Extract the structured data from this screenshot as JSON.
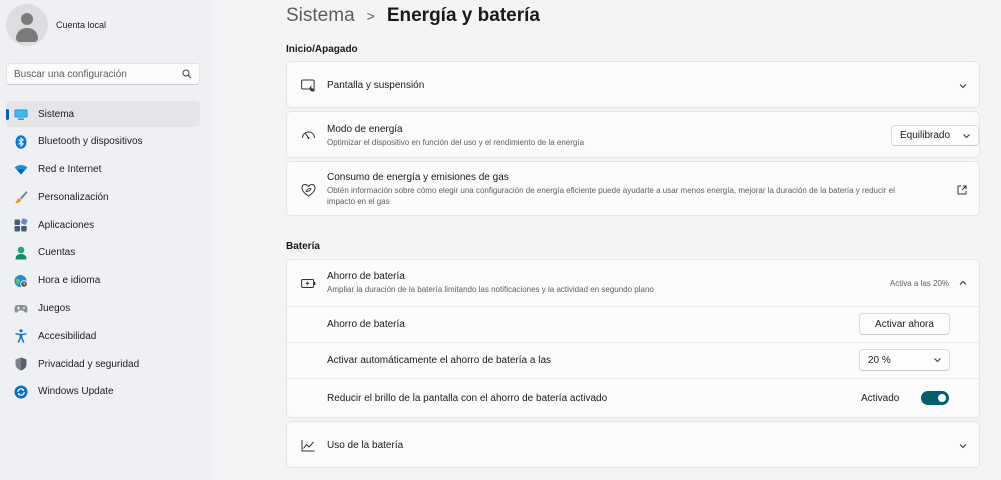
{
  "profile": {
    "name": "Cuenta local"
  },
  "search": {
    "placeholder": "Buscar una configuración"
  },
  "sidebar": {
    "items": [
      {
        "label": "Sistema",
        "icon": "system-icon",
        "active": true
      },
      {
        "label": "Bluetooth y dispositivos",
        "icon": "bluetooth-icon"
      },
      {
        "label": "Red e Internet",
        "icon": "wifi-icon"
      },
      {
        "label": "Personalización",
        "icon": "brush-icon"
      },
      {
        "label": "Aplicaciones",
        "icon": "apps-icon"
      },
      {
        "label": "Cuentas",
        "icon": "accounts-icon"
      },
      {
        "label": "Hora e idioma",
        "icon": "globe-clock-icon"
      },
      {
        "label": "Juegos",
        "icon": "gamepad-icon"
      },
      {
        "label": "Accesibilidad",
        "icon": "accessibility-icon"
      },
      {
        "label": "Privacidad y seguridad",
        "icon": "shield-icon"
      },
      {
        "label": "Windows Update",
        "icon": "update-icon"
      }
    ]
  },
  "header": {
    "parent": "Sistema",
    "separator": ">",
    "current": "Energía y batería"
  },
  "power_section": {
    "title": "Inicio/Apagado",
    "screen_sleep": {
      "title": "Pantalla y suspensión"
    },
    "power_mode": {
      "title": "Modo de energía",
      "desc": "Optimizar el dispositivo en función del uso y el rendimiento de la energía",
      "value": "Equilibrado"
    },
    "consumption": {
      "title": "Consumo de energía y emisiones de gas",
      "desc_line1": "Obtén información sobre cómo elegir una configuración de energía eficiente puede ayudarte a usar menos energía, mejorar la duración de la batería y reducir el",
      "desc_line2": "impacto en el gas"
    }
  },
  "battery_section": {
    "title": "Batería",
    "saver": {
      "title": "Ahorro de batería",
      "desc": "Ampliar la duración de la batería limitando las notificaciones y la actividad en segundo plano",
      "status": "Activa a las 20%"
    },
    "saver_now": {
      "label": "Ahorro de batería",
      "button": "Activar ahora"
    },
    "auto_on": {
      "label": "Activar automáticamente el ahorro de batería a las",
      "value": "20 %"
    },
    "brightness": {
      "label": "Reducir el brillo de la pantalla con el ahorro de batería activado",
      "state": "Activado",
      "on": true
    },
    "usage": {
      "title": "Uso de la batería"
    }
  },
  "colors": {
    "accent": "#005fb8",
    "toggle_on": "#005f6b"
  }
}
